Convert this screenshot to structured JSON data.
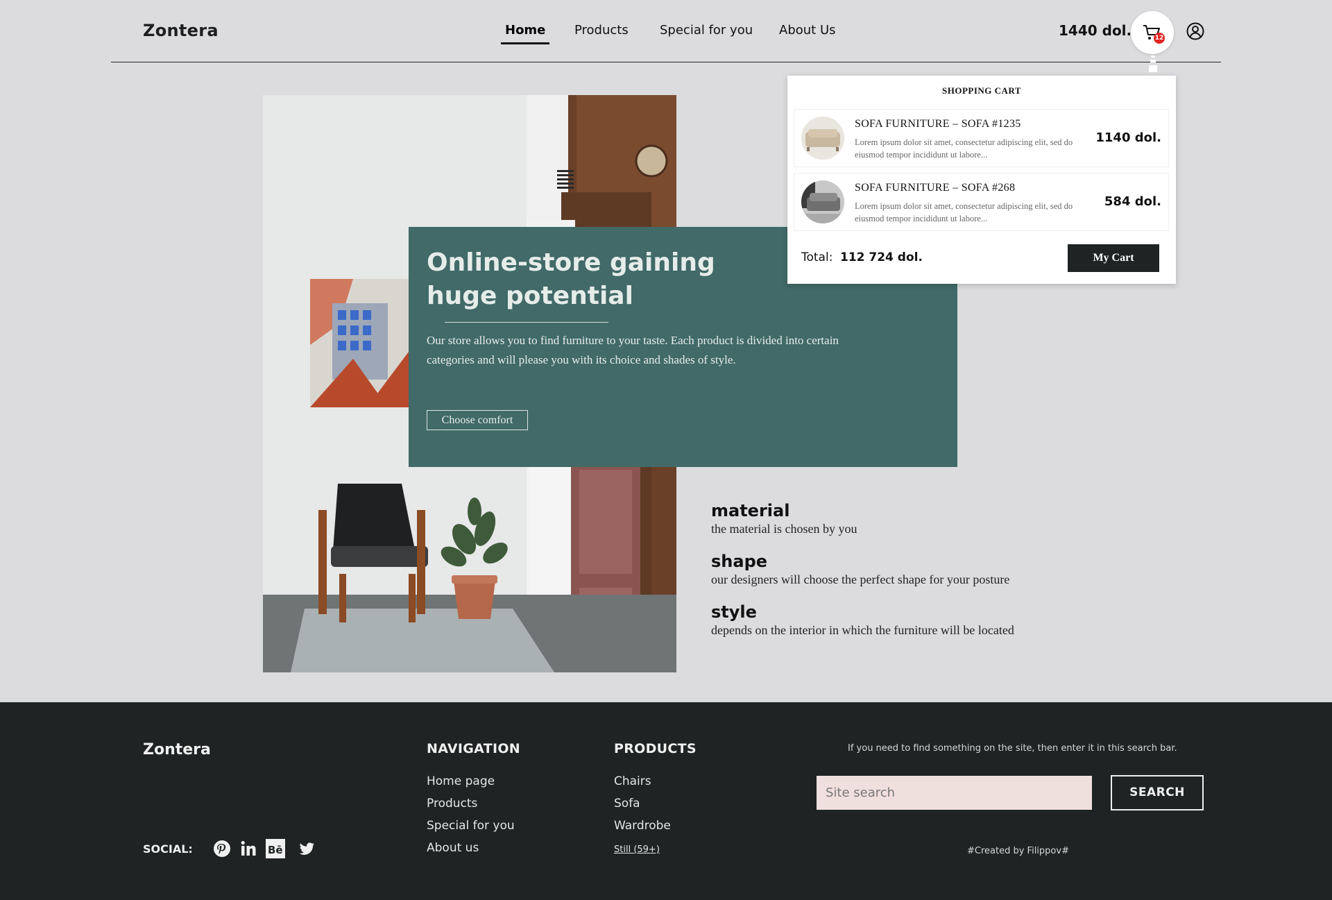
{
  "header": {
    "logo": "Zontera",
    "nav": [
      {
        "label": "Home",
        "active": true
      },
      {
        "label": "Products",
        "active": false
      },
      {
        "label": "Special for you",
        "active": false
      },
      {
        "label": "About Us",
        "active": false
      }
    ],
    "cart_total": "1440 dol.",
    "cart_count": "12",
    "icons": {
      "cart": "cart-icon",
      "user": "user-icon"
    }
  },
  "hero": {
    "title": "Online-store gaining huge potential",
    "text": "Our store allows you to find furniture to your taste. Each product is divided into certain categories and will please you with its choice and shades of style.",
    "button": "Choose comfort",
    "card_color": "#416a68"
  },
  "features": [
    {
      "title": "material",
      "desc": "the material is chosen by you"
    },
    {
      "title": "shape",
      "desc": "our designers will choose the perfect shape for your posture"
    },
    {
      "title": "style",
      "desc": "depends on the interior in which the furniture will be located"
    }
  ],
  "cart": {
    "title": "SHOPPING CART",
    "items": [
      {
        "title": "SOFA FURNITURE – SOFA #1235",
        "desc": "Lorem ipsum dolor sit amet, consectetur adipiscing elit, sed do eiusmod tempor incididunt ut labore...",
        "price": "1140 dol."
      },
      {
        "title": "SOFA FURNITURE – SOFA #268",
        "desc": "Lorem ipsum dolor sit amet, consectetur adipiscing elit, sed do eiusmod tempor incididunt ut labore...",
        "price": "584 dol."
      }
    ],
    "total_label": "Total:",
    "total_value": "112 724 dol.",
    "button": "My Cart"
  },
  "footer": {
    "logo": "Zontera",
    "social_label": "SOCIAL:",
    "social_icons": [
      "pinterest-icon",
      "linkedin-icon",
      "behance-icon",
      "twitter-icon"
    ],
    "navigation": {
      "heading": "NAVIGATION",
      "links": [
        "Home page",
        "Products",
        "Special for you",
        "About us"
      ]
    },
    "products": {
      "heading": "PRODUCTS",
      "links": [
        "Chairs",
        "Sofa",
        "Wardrobe"
      ],
      "more": "Still (59+)"
    },
    "search_hint": "If you need to find something on the site, then enter it in this search bar.",
    "search_placeholder": "Site search",
    "search_button": "SEARCH",
    "credit": "#Created by Filippov#"
  }
}
